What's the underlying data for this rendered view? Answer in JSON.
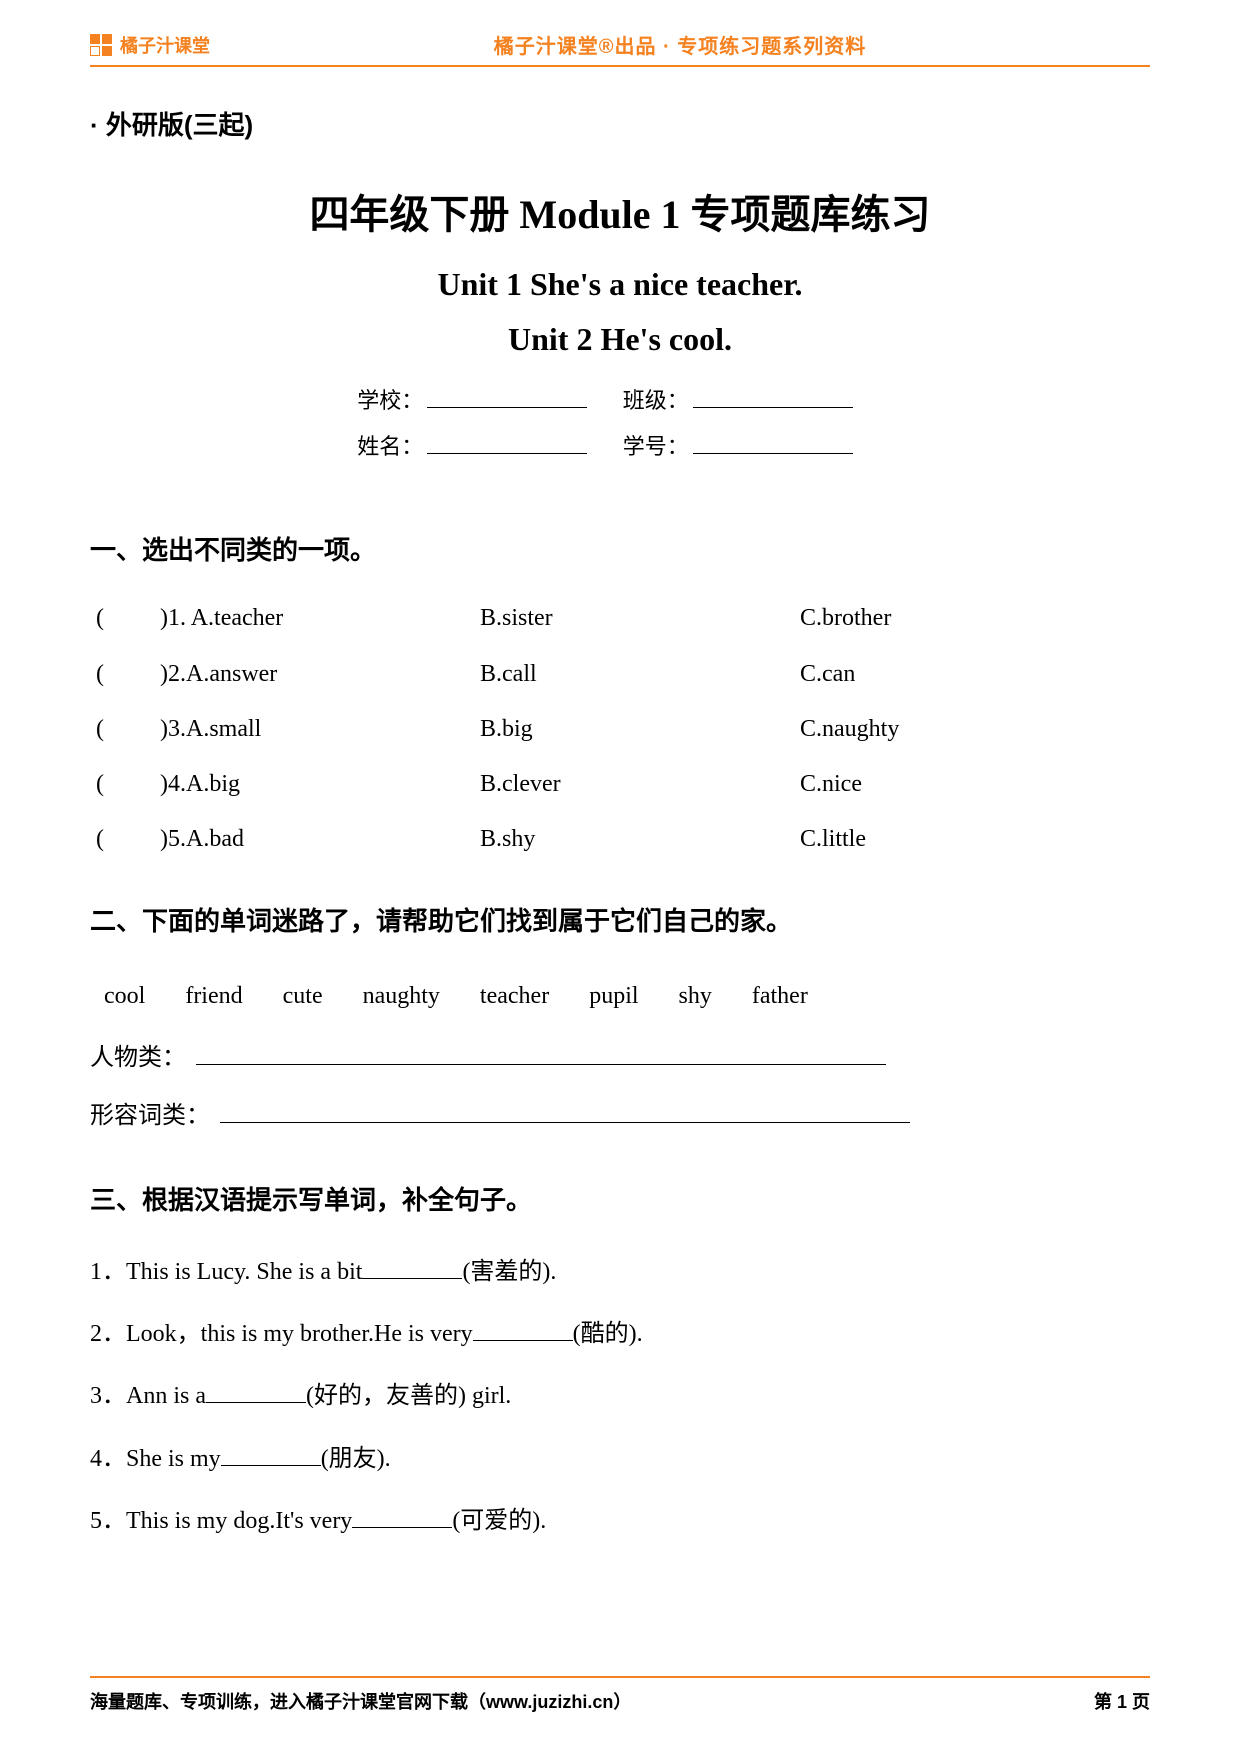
{
  "header": {
    "brand": "橘子汁课堂",
    "tagline": "橘子汁课堂®出品 · 专项练习题系列资料"
  },
  "edition": "· 外研版(三起)",
  "titles": {
    "main": "四年级下册 Module 1 专项题库练习",
    "sub1": "Unit 1 She's a nice teacher.",
    "sub2": "Unit 2 He's cool."
  },
  "info": {
    "school_label": "学校：",
    "class_label": "班级：",
    "name_label": "姓名：",
    "id_label": "学号："
  },
  "sections": {
    "s1": {
      "title": "一、选出不同类的一项。",
      "items": [
        {
          "n": "1.",
          "a": "A.teacher",
          "b": "B.sister",
          "c": "C.brother"
        },
        {
          "n": "2.",
          "a": "A.answer",
          "b": "B.call",
          "c": "C.can"
        },
        {
          "n": "3.",
          "a": "A.small",
          "b": "B.big",
          "c": "C.naughty"
        },
        {
          "n": "4.",
          "a": "A.big",
          "b": "B.clever",
          "c": "C.nice"
        },
        {
          "n": "5.",
          "a": "A.bad",
          "b": "B.shy",
          "c": "C.little"
        }
      ]
    },
    "s2": {
      "title": "二、下面的单词迷路了，请帮助它们找到属于它们自己的家。",
      "bank": "cool friend cute naughty teacher pupil shy father",
      "cat1": "人物类：",
      "cat2": "形容词类："
    },
    "s3": {
      "title": "三、根据汉语提示写单词，补全句子。",
      "items": [
        {
          "pre": "1．This is Lucy. She is a bit",
          "hint": "(害羞的)."
        },
        {
          "pre": "2．Look，this is my brother.He is very",
          "hint": "(酷的)."
        },
        {
          "pre": "3．Ann is a",
          "hint": "(好的，友善的) girl."
        },
        {
          "pre": "4．She is my",
          "hint": "(朋友)."
        },
        {
          "pre": "5．This is my dog.It's very",
          "hint": "(可爱的)."
        }
      ]
    }
  },
  "footer": {
    "left": "海量题库、专项训练，进入橘子汁课堂官网下载（www.juzizhi.cn）",
    "right": "第 1 页"
  }
}
